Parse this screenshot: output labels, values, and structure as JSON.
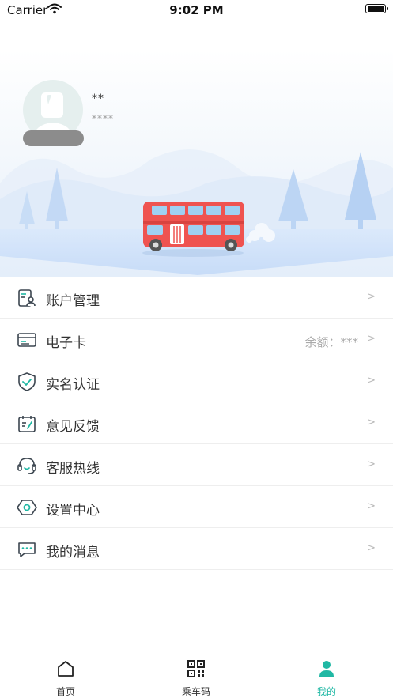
{
  "status_bar": {
    "carrier": "Carrier",
    "time": "9:02 PM"
  },
  "profile": {
    "name": "**",
    "subtitle": "****"
  },
  "menu": [
    {
      "label": "账户管理",
      "value": "",
      "chevron": ">",
      "icon": "account-management-icon"
    },
    {
      "label": "电子卡",
      "value": "余额：***",
      "chevron": ">",
      "icon": "card-icon"
    },
    {
      "label": "实名认证",
      "value": "",
      "chevron": ">",
      "icon": "shield-check-icon"
    },
    {
      "label": "意见反馈",
      "value": "",
      "chevron": ">",
      "icon": "feedback-icon"
    },
    {
      "label": "客服热线",
      "value": "",
      "chevron": ">",
      "icon": "headset-icon"
    },
    {
      "label": "设置中心",
      "value": "",
      "chevron": ">",
      "icon": "settings-icon"
    },
    {
      "label": "我的消息",
      "value": "",
      "chevron": ">",
      "icon": "message-icon"
    }
  ],
  "tab_bar": [
    {
      "label": "首页",
      "icon": "home-icon",
      "active": false
    },
    {
      "label": "乘车码",
      "icon": "qr-code-icon",
      "active": false
    },
    {
      "label": "我的",
      "icon": "user-icon",
      "active": true
    }
  ],
  "colors": {
    "accent": "#20b8a4",
    "icon_stroke": "#3c4650",
    "bus": "#ef5350",
    "sky": "#eaf3fb"
  }
}
